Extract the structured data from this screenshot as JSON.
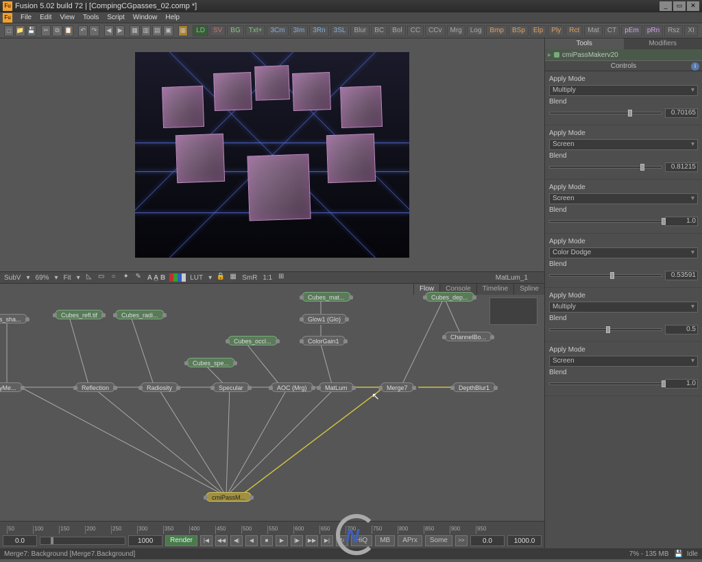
{
  "app": {
    "title": "Fusion 5.02 build 72  |  [CompingCGpasses_02.comp *]"
  },
  "menu": [
    "File",
    "Edit",
    "View",
    "Tools",
    "Script",
    "Window",
    "Help"
  ],
  "pass_buttons": [
    {
      "t": "LD",
      "c": "green",
      "on": true
    },
    {
      "t": "SV",
      "c": "red"
    },
    {
      "t": "BG",
      "c": "green"
    },
    {
      "t": "Txt+",
      "c": "green"
    },
    {
      "t": "3Cm",
      "c": "blue"
    },
    {
      "t": "3Im",
      "c": "blue"
    },
    {
      "t": "3Rn",
      "c": "blue"
    },
    {
      "t": "3SL",
      "c": "blue"
    },
    {
      "t": "Blur",
      "c": "grey"
    },
    {
      "t": "BC",
      "c": "grey"
    },
    {
      "t": "Bol",
      "c": "grey"
    },
    {
      "t": "CC",
      "c": "grey"
    },
    {
      "t": "CCv",
      "c": "grey"
    },
    {
      "t": "Mrg",
      "c": "grey"
    },
    {
      "t": "Log",
      "c": "grey"
    },
    {
      "t": "Bmp",
      "c": "orange"
    },
    {
      "t": "BSp",
      "c": "orange"
    },
    {
      "t": "Elp",
      "c": "orange"
    },
    {
      "t": "Ply",
      "c": "orange"
    },
    {
      "t": "Rct",
      "c": "orange"
    },
    {
      "t": "Mat",
      "c": "grey"
    },
    {
      "t": "CT",
      "c": "grey"
    },
    {
      "t": "pEm",
      "c": "purple"
    },
    {
      "t": "pRn",
      "c": "purple"
    },
    {
      "t": "Rsz",
      "c": "grey"
    },
    {
      "t": "XI",
      "c": "grey"
    }
  ],
  "viewer": {
    "sub": "SubV",
    "zoom": "69%",
    "fit": "Fit",
    "lut": "LUT",
    "smr": "SmR",
    "ratio": "1:1",
    "label": "MatLum_1"
  },
  "flow_tabs": [
    "Flow",
    "Console",
    "Timeline",
    "Spline"
  ],
  "nodes": {
    "sha": "s_sha...",
    "refl": "Cubes_refl.tif",
    "radi": "Cubes_radi...",
    "occl": "Cubes_occl...",
    "spec": "Cubes_spe...",
    "mat": "Cubes_mat...",
    "dep": "Cubes_dep...",
    "glow": "Glow1  (Glo)",
    "cgain": "ColorGain1",
    "chanbo": "ChannelBo...",
    "reflection": "Reflection",
    "radiosity": "Radiosity",
    "specular": "Specular",
    "aoc": "AOC  (Mrg)",
    "matlum": "MatLum",
    "merge7": "Merge7",
    "depthblur": "DepthBlur1",
    "yme": "yMe...",
    "passmaker": "cmiPassM..."
  },
  "timeline": {
    "ticks": [
      "50",
      "100",
      "150",
      "200",
      "250",
      "300",
      "350",
      "400",
      "450",
      "500",
      "550",
      "600",
      "650",
      "700",
      "750",
      "800",
      "850",
      "900",
      "950"
    ],
    "start": "0.0",
    "end": "1000",
    "render": "Render",
    "hiq": "HiQ",
    "mb": "MB",
    "aprx": "APrx",
    "some": "Some",
    "end2": "1000.0",
    "cur": "0.0"
  },
  "status": {
    "left": "Merge7: Background  [Merge7.Background]",
    "mem": "7% - 135 MB",
    "idle": "Idle"
  },
  "panel": {
    "tabs": [
      "Tools",
      "Modifiers"
    ],
    "node": "cmiPassMakerv20",
    "controls_label": "Controls",
    "groups": [
      {
        "apply_label": "Apply Mode",
        "mode": "Multiply",
        "blend_label": "Blend",
        "blend": "0.70165",
        "pos": 70
      },
      {
        "apply_label": "Apply Mode",
        "mode": "Screen",
        "blend_label": "Blend",
        "blend": "0.81215",
        "pos": 81
      },
      {
        "apply_label": "Apply Mode",
        "mode": "Screen",
        "blend_label": "Blend",
        "blend": "1.0",
        "pos": 100
      },
      {
        "apply_label": "Apply Mode",
        "mode": "Color Dodge",
        "blend_label": "Blend",
        "blend": "0.53591",
        "pos": 54
      },
      {
        "apply_label": "Apply Mode",
        "mode": "Multiply",
        "blend_label": "Blend",
        "blend": "0.5",
        "pos": 50
      },
      {
        "apply_label": "Apply Mode",
        "mode": "Screen",
        "blend_label": "Blend",
        "blend": "1.0",
        "pos": 100
      }
    ]
  }
}
